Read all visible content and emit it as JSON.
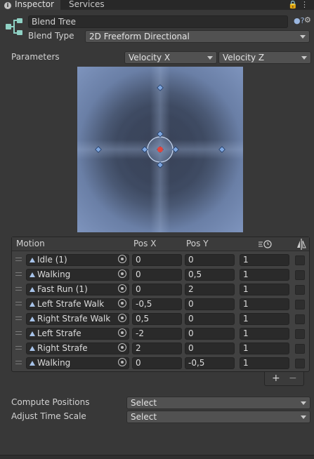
{
  "tabs": {
    "inspector": "Inspector",
    "services": "Services"
  },
  "blend_tree": {
    "name": "Blend Tree",
    "blend_type_label": "Blend Type",
    "blend_type_value": "2D Freeform Directional"
  },
  "parameters": {
    "label": "Parameters",
    "param_x": "Velocity X",
    "param_y": "Velocity Z"
  },
  "columns": {
    "motion": "Motion",
    "pos_x": "Pos X",
    "pos_y": "Pos Y"
  },
  "motions": [
    {
      "name": "Idle (1)",
      "x": "0",
      "y": "0",
      "speed": "1"
    },
    {
      "name": "Walking",
      "x": "0",
      "y": "0,5",
      "speed": "1"
    },
    {
      "name": "Fast Run (1)",
      "x": "0",
      "y": "2",
      "speed": "1"
    },
    {
      "name": "Left Strafe Walk",
      "x": "-0,5",
      "y": "0",
      "speed": "1"
    },
    {
      "name": "Right Strafe Walk",
      "x": "0,5",
      "y": "0",
      "speed": "1"
    },
    {
      "name": "Left Strafe",
      "x": "-2",
      "y": "0",
      "speed": "1"
    },
    {
      "name": "Right Strafe",
      "x": "2",
      "y": "0",
      "speed": "1"
    },
    {
      "name": "Walking",
      "x": "0",
      "y": "-0,5",
      "speed": "1"
    }
  ],
  "buttons": {
    "add": "+",
    "remove": "−"
  },
  "compute_positions": {
    "label": "Compute Positions",
    "value": "Select"
  },
  "adjust_time_scale": {
    "label": "Adjust Time Scale",
    "value": "Select"
  },
  "colors": {
    "accent": "#7fa7e0",
    "selected_point": "#e0443c",
    "background": "#383838"
  },
  "icons": [
    "info-icon",
    "lock-icon",
    "menu-icon",
    "blend-tree-icon",
    "help-icon",
    "settings-icon",
    "animation-clip-icon",
    "object-picker-icon",
    "clock-icon",
    "mirror-icon"
  ]
}
